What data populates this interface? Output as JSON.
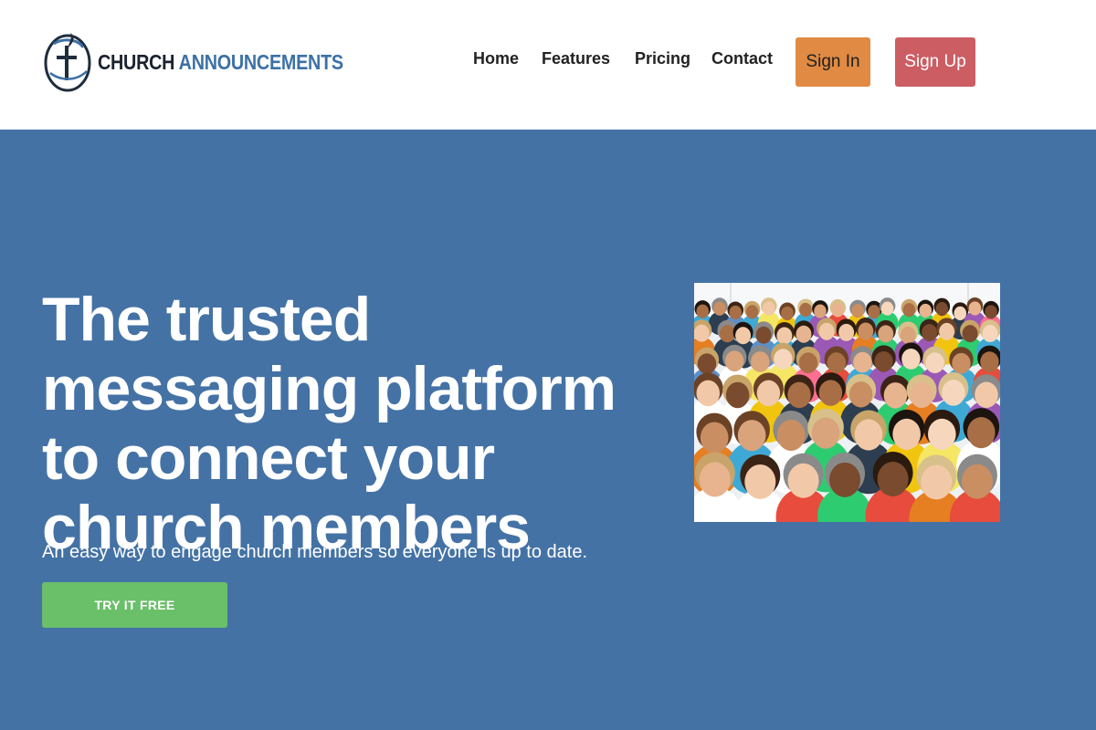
{
  "brand": {
    "name_part1": "CHURCH",
    "name_part2": "ANNOUNCEMENTS",
    "logo_icon": "cross-circle-logo-icon"
  },
  "nav": {
    "links": [
      "Home",
      "Features",
      "Pricing",
      "Contact"
    ],
    "sign_in": "Sign In",
    "sign_up": "Sign Up"
  },
  "hero": {
    "title": "The trusted messaging platform to connect your church members",
    "subtitle": "An easy way to engage church members so everyone is up to date.",
    "cta_label": "TRY IT FREE",
    "image_alt": "Crowd of smiling people of all ages"
  },
  "colors": {
    "hero_bg": "#4472a5",
    "sign_in_bg": "#e08a43",
    "sign_up_bg": "#cb5d63",
    "cta_bg": "#6abf69",
    "brand_blue": "#3d71a6"
  }
}
